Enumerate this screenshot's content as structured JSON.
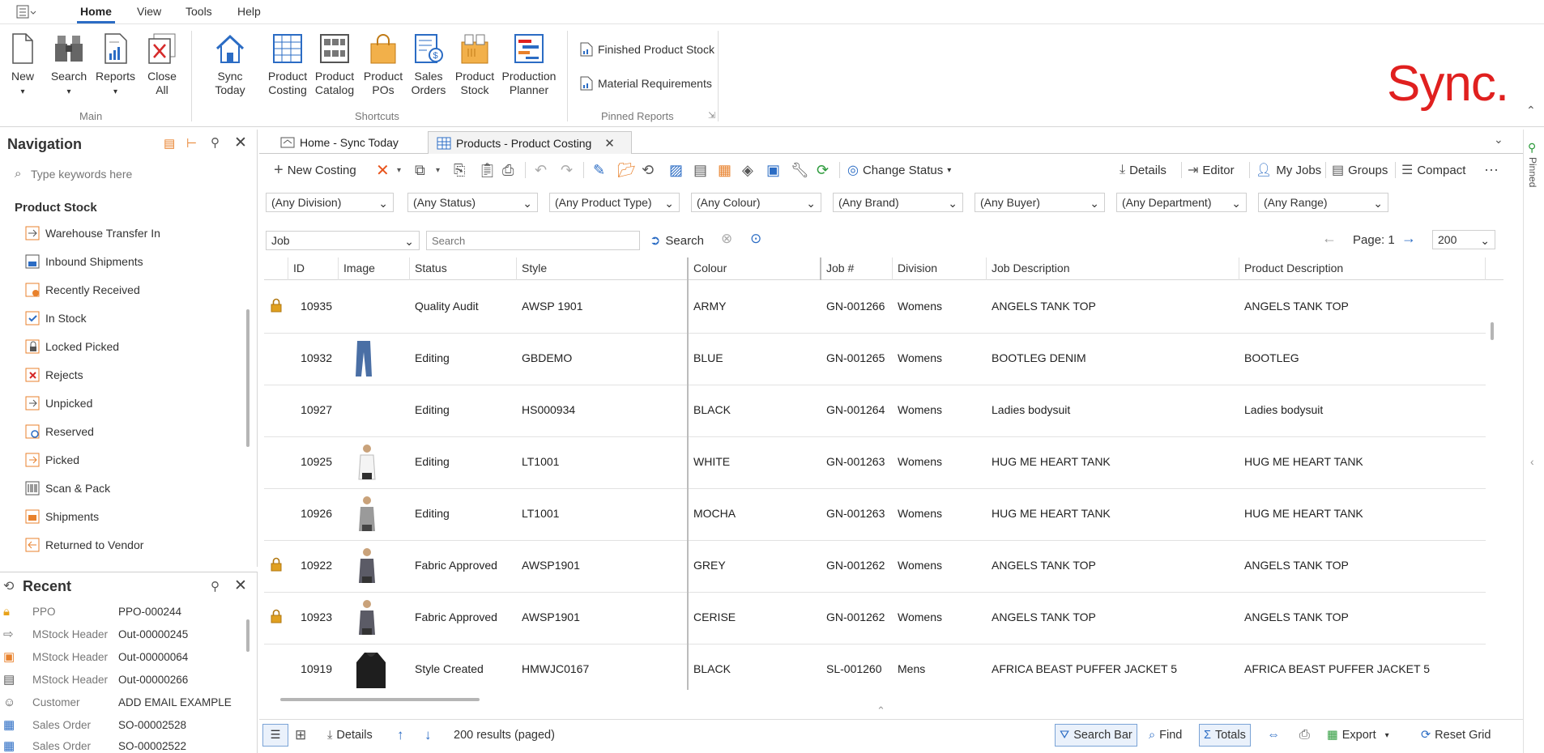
{
  "menubar": {
    "items": [
      "Home",
      "View",
      "Tools",
      "Help"
    ],
    "active": "Home"
  },
  "ribbon": {
    "main": {
      "new": "New",
      "search": "Search",
      "reports": "Reports",
      "close_all_1": "Close",
      "close_all_2": "All",
      "label": "Main"
    },
    "shortcuts": {
      "sync_today": "Sync Today",
      "product_costing_1": "Product",
      "product_costing_2": "Costing",
      "product_catalog_1": "Product",
      "product_catalog_2": "Catalog",
      "product_pos_1": "Product",
      "product_pos_2": "POs",
      "sales_orders_1": "Sales",
      "sales_orders_2": "Orders",
      "product_stock_1": "Product",
      "product_stock_2": "Stock",
      "production_planner_1": "Production",
      "production_planner_2": "Planner",
      "label": "Shortcuts"
    },
    "pinned_reports": {
      "items": [
        "Finished Product Stock",
        "Material Requirements"
      ],
      "label": "Pinned Reports"
    },
    "logo": "Sync."
  },
  "navigation": {
    "title": "Navigation",
    "search_placeholder": "Type keywords here",
    "section": "Product Stock",
    "items": [
      "Warehouse Transfer In",
      "Inbound Shipments",
      "Recently Received",
      "In Stock",
      "Locked Picked",
      "Rejects",
      "Unpicked",
      "Reserved",
      "Picked",
      "Scan & Pack",
      "Shipments",
      "Returned to Vendor"
    ]
  },
  "recent": {
    "title": "Recent",
    "rows": [
      {
        "type": "PPO",
        "value": "PPO-000244"
      },
      {
        "type": "MStock Header",
        "value": "Out-00000245"
      },
      {
        "type": "MStock Header",
        "value": "Out-00000064"
      },
      {
        "type": "MStock Header",
        "value": "Out-00000266"
      },
      {
        "type": "Customer",
        "value": "ADD EMAIL EXAMPLE"
      },
      {
        "type": "Sales Order",
        "value": "SO-00002528"
      },
      {
        "type": "Sales Order",
        "value": "SO-00002522"
      }
    ]
  },
  "tabs": [
    {
      "label": "Home - Sync Today"
    },
    {
      "label": "Products - Product Costing"
    }
  ],
  "toolbar": {
    "new_costing": "New Costing",
    "change_status": "Change Status",
    "details": "Details",
    "editor": "Editor",
    "my_jobs": "My Jobs",
    "groups": "Groups",
    "compact": "Compact",
    "pinned": "Pinned"
  },
  "filters": [
    "(Any Division)",
    "(Any Status)",
    "(Any Product Type)",
    "(Any Colour)",
    "(Any Brand)",
    "(Any Buyer)",
    "(Any Department)",
    "(Any Range)"
  ],
  "searchbar": {
    "field": "Job",
    "placeholder": "Search",
    "button": "Search",
    "page_label": "Page: 1",
    "page_size": "200"
  },
  "grid": {
    "columns": [
      "ID",
      "Image",
      "Status",
      "Style",
      "Colour",
      "Job #",
      "Division",
      "Job Description",
      "Product Description"
    ],
    "rows": [
      {
        "locked": true,
        "id": "10935",
        "image": "",
        "status": "Quality Audit",
        "style": "AWSP 1901",
        "colour": "ARMY",
        "job": "GN-001266",
        "division": "Womens",
        "job_desc": "ANGELS TANK TOP",
        "prod_desc": "ANGELS TANK TOP"
      },
      {
        "locked": false,
        "id": "10932",
        "image": "jeans",
        "status": "Editing",
        "style": "GBDEMO",
        "colour": "BLUE",
        "job": "GN-001265",
        "division": "Womens",
        "job_desc": "BOOTLEG DENIM",
        "prod_desc": "BOOTLEG"
      },
      {
        "locked": false,
        "id": "10927",
        "image": "",
        "status": "Editing",
        "style": "HS000934",
        "colour": "BLACK",
        "job": "GN-001264",
        "division": "Womens",
        "job_desc": "Ladies bodysuit",
        "prod_desc": "Ladies bodysuit"
      },
      {
        "locked": false,
        "id": "10925",
        "image": "tank-white",
        "status": "Editing",
        "style": "LT1001",
        "colour": "WHITE",
        "job": "GN-001263",
        "division": "Womens",
        "job_desc": "HUG ME HEART TANK",
        "prod_desc": "HUG ME HEART TANK"
      },
      {
        "locked": false,
        "id": "10926",
        "image": "tank-grey",
        "status": "Editing",
        "style": "LT1001",
        "colour": "MOCHA",
        "job": "GN-001263",
        "division": "Womens",
        "job_desc": "HUG ME HEART TANK",
        "prod_desc": "HUG ME HEART TANK"
      },
      {
        "locked": true,
        "id": "10922",
        "image": "tank-dark",
        "status": "Fabric Approved",
        "style": "AWSP1901",
        "colour": "GREY",
        "job": "GN-001262",
        "division": "Womens",
        "job_desc": "ANGELS TANK TOP",
        "prod_desc": "ANGELS TANK TOP"
      },
      {
        "locked": true,
        "id": "10923",
        "image": "tank-dark",
        "status": "Fabric Approved",
        "style": "AWSP1901",
        "colour": "CERISE",
        "job": "GN-001262",
        "division": "Womens",
        "job_desc": "ANGELS TANK TOP",
        "prod_desc": "ANGELS TANK TOP"
      },
      {
        "locked": false,
        "id": "10919",
        "image": "hoodie",
        "status": "Style Created",
        "style": "HMWJC0167",
        "colour": "BLACK",
        "job": "SL-001260",
        "division": "Mens",
        "job_desc": "AFRICA BEAST PUFFER JACKET 5",
        "prod_desc": "AFRICA BEAST PUFFER JACKET 5"
      }
    ]
  },
  "statusbar": {
    "details": "Details",
    "results": "200 results (paged)",
    "search_bar": "Search Bar",
    "find": "Find",
    "totals": "Totals",
    "export": "Export",
    "reset_grid": "Reset Grid"
  },
  "colors": {
    "accent": "#2b6cc4",
    "brand": "#e0201f",
    "icon_orange": "#e8812c",
    "lock": "#d98a1a"
  }
}
